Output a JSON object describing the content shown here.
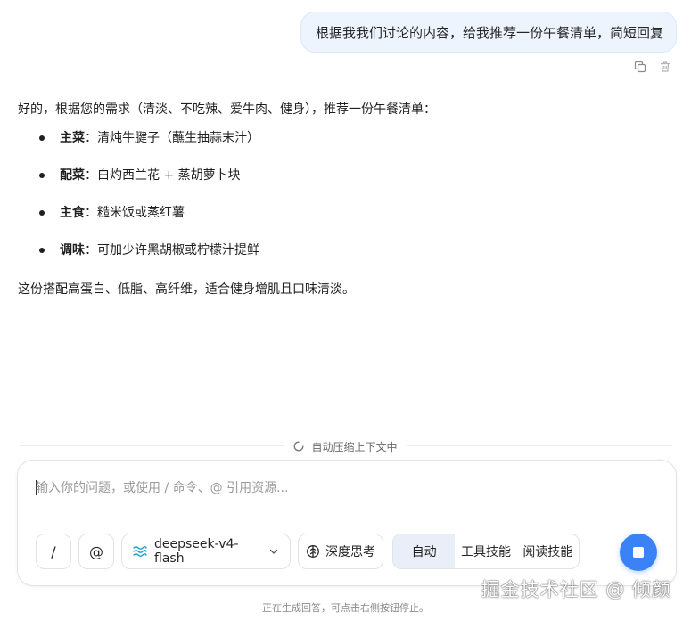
{
  "user_message": {
    "text": "根据我我们讨论的内容，给我推荐一份午餐清单，简短回复",
    "actions": [
      {
        "icon": "copy-icon"
      },
      {
        "icon": "trash-icon"
      }
    ]
  },
  "assistant_message": {
    "intro": "好的，根据您的需求（清淡、不吃辣、爱牛肉、健身），推荐一份午餐清单：",
    "items": [
      {
        "label": "主菜",
        "text": "：清炖牛腱子（蘸生抽蒜末汁）"
      },
      {
        "label": "配菜",
        "text": "：白灼西兰花 + 蒸胡萝卜块"
      },
      {
        "label": "主食",
        "text": "：糙米饭或蒸红薯"
      },
      {
        "label": "调味",
        "text": "：可加少许黑胡椒或柠檬汁提鲜"
      }
    ],
    "summary": "这份搭配高蛋白、低脂、高纤维，适合健身增肌且口味清淡。"
  },
  "context_status": {
    "icon": "spinner-icon",
    "text": "自动压缩上下文中"
  },
  "composer": {
    "placeholder": "输入你的问题，或使用 / 命令、@ 引用资源...",
    "value": "",
    "slash_label": "/",
    "at_label": "@",
    "model": {
      "icon": "waves-icon",
      "label": "deepseek-v4-flash",
      "dropdown_icon": "chevron-down-icon"
    },
    "deep_think": {
      "icon": "brain-icon",
      "label": "深度思考"
    },
    "modes": [
      {
        "label": "自动",
        "active": true
      },
      {
        "label": "工具技能",
        "active": false
      },
      {
        "label": "阅读技能",
        "active": false
      }
    ],
    "stop_button": {
      "icon": "stop-icon"
    }
  },
  "footer_note": "正在生成回答，可点击右侧按钮停止。",
  "watermark": "掘金技术社区 @ 倾颜",
  "colors": {
    "accent": "#3b82f6",
    "user_bubble_bg": "#eef4fe",
    "active_mode_bg": "#e9eef8"
  }
}
